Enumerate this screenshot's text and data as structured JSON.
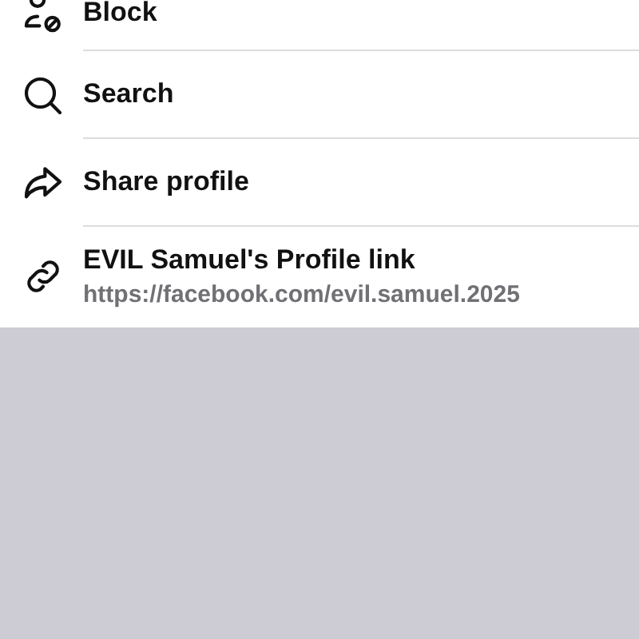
{
  "menu": {
    "items": [
      {
        "kind": "block",
        "label": "Block"
      },
      {
        "kind": "search",
        "label": "Search"
      },
      {
        "kind": "share",
        "label": "Share profile"
      },
      {
        "kind": "link",
        "label": "EVIL Samuel's Profile link",
        "subtitle": "https://facebook.com/evil.samuel.2025"
      }
    ]
  }
}
